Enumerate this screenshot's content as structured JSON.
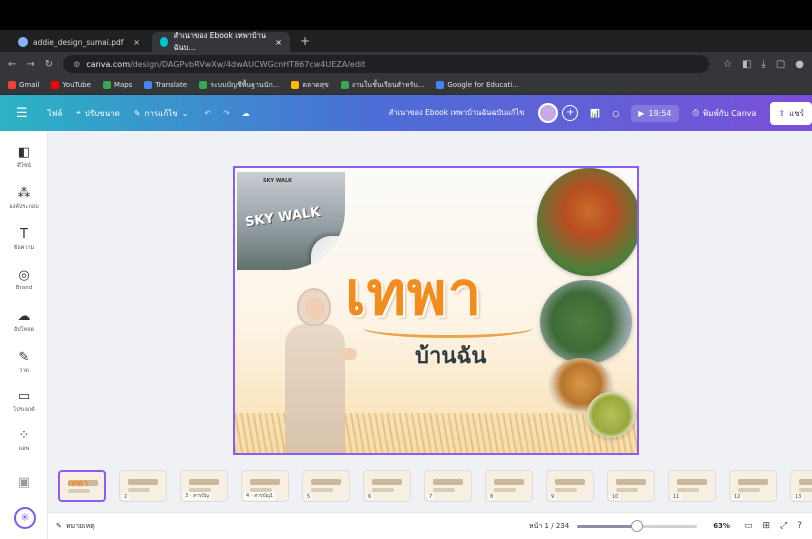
{
  "browser": {
    "tabs": [
      {
        "label": "addie_design_sumai.pdf",
        "active": false,
        "close": "×"
      },
      {
        "label": "สำเนาของ Ebook เทพาบ้านฉันบ...",
        "active": true,
        "close": "×"
      }
    ],
    "new_tab": "+",
    "url_host": "canva.com",
    "url_path": "/design/DAGPvbRVwXw/4dwAUCWGcnHT867cw4UEZA/edit",
    "bookmarks": [
      {
        "label": "Gmail",
        "color": "#ea4335"
      },
      {
        "label": "YouTube",
        "color": "#ff0000"
      },
      {
        "label": "Maps",
        "color": "#34a853"
      },
      {
        "label": "Translate",
        "color": "#4285f4"
      },
      {
        "label": "ระบบบัญชีพื้นฐานนัก...",
        "color": "#34a853"
      },
      {
        "label": "ตลาดสุข",
        "color": "#fbbc05"
      },
      {
        "label": "งานในชั้นเรียนสำหรับ...",
        "color": "#34a853"
      },
      {
        "label": "Google for Educati...",
        "color": "#4285f4"
      }
    ]
  },
  "toolbar": {
    "menu_icon": "hamburger-icon",
    "file": "ไฟล์",
    "resize": "ปรับขนาด",
    "edit": "การแก้ไข",
    "doc_title": "สำเนาของ Ebook เทพาบ้านฉันฉบับแก้ไข",
    "present_time": "19:54",
    "print": "พิมพ์กับ Canva",
    "share": "แชร์"
  },
  "sidebar": {
    "items": [
      {
        "label": "ดีไซน์",
        "icon": "design-icon"
      },
      {
        "label": "องค์ประกอบ",
        "icon": "elements-icon"
      },
      {
        "label": "ข้อความ",
        "icon": "text-icon"
      },
      {
        "label": "Brand",
        "icon": "brand-icon"
      },
      {
        "label": "อัปโหลด",
        "icon": "upload-icon"
      },
      {
        "label": "วาด",
        "icon": "draw-icon"
      },
      {
        "label": "โปรเจกต์",
        "icon": "projects-icon"
      },
      {
        "label": "แอพ",
        "icon": "apps-icon"
      }
    ]
  },
  "slide": {
    "title": "เทพา",
    "subtitle": "บ้านฉัน",
    "skywalk_text": "SKY WALK",
    "skywalk_small": "SKY WALK"
  },
  "pages": [
    {
      "num": "",
      "title": "เทพา",
      "selected": true
    },
    {
      "num": "2",
      "title": "",
      "selected": false
    },
    {
      "num": "3 · สารบัญ",
      "title": "",
      "selected": false
    },
    {
      "num": "4 · สารบัญ1",
      "title": "",
      "selected": false
    },
    {
      "num": "5",
      "title": "",
      "selected": false
    },
    {
      "num": "6",
      "title": "",
      "selected": false
    },
    {
      "num": "7",
      "title": "",
      "selected": false
    },
    {
      "num": "8",
      "title": "",
      "selected": false
    },
    {
      "num": "9",
      "title": "",
      "selected": false
    },
    {
      "num": "10",
      "title": "",
      "selected": false
    },
    {
      "num": "11",
      "title": "",
      "selected": false
    },
    {
      "num": "12",
      "title": "",
      "selected": false
    },
    {
      "num": "13",
      "title": "",
      "selected": false
    }
  ],
  "footer": {
    "notes": "หมายเหตุ",
    "page_indicator": "หน้า 1 / 234",
    "zoom": "63%",
    "zoom_fraction": 0.5
  }
}
